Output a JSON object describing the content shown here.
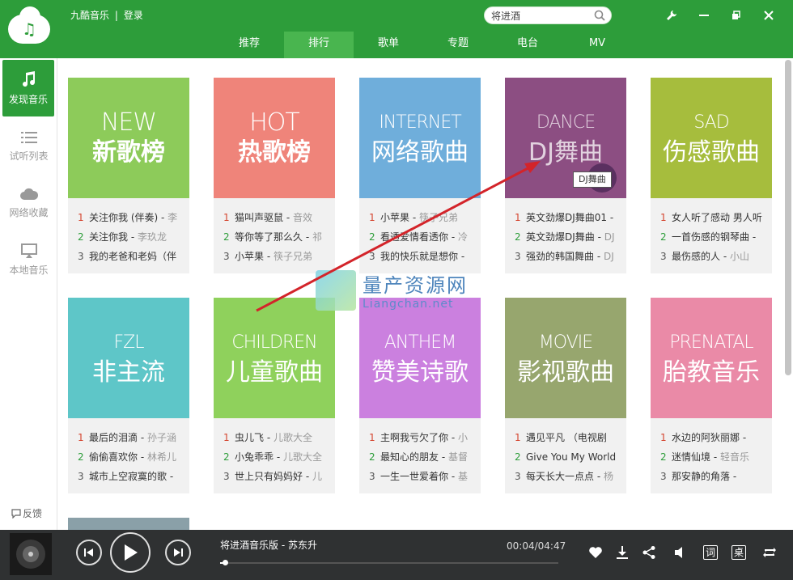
{
  "app": {
    "title": "九酷音乐",
    "separator": "|",
    "login": "登录"
  },
  "search": {
    "value": "将进酒",
    "placeholder": ""
  },
  "nav": {
    "tabs": [
      "推荐",
      "排行",
      "歌单",
      "专题",
      "电台",
      "MV"
    ],
    "active": "排行"
  },
  "sidebar": {
    "items": [
      {
        "label": "发现音乐",
        "icon": "music-note-icon",
        "active": true
      },
      {
        "label": "试听列表",
        "icon": "list-icon",
        "active": false
      },
      {
        "label": "网络收藏",
        "icon": "cloud-icon",
        "active": false
      },
      {
        "label": "本地音乐",
        "icon": "monitor-icon",
        "active": false
      }
    ],
    "feedback": "反馈"
  },
  "charts": [
    {
      "en": "NEW",
      "cn": "新歌榜",
      "color": "#8dcb5a",
      "songs": [
        {
          "title": "关注你我 (伴奏)",
          "artist": "李"
        },
        {
          "title": "关注你我",
          "artist": "李玖龙"
        },
        {
          "title": "我的老爸和老妈（伴",
          "artist": ""
        }
      ]
    },
    {
      "en": "HOT",
      "cn": "热歌榜",
      "color": "#ef847a",
      "songs": [
        {
          "title": "猫叫声驱鼠",
          "artist": "音效"
        },
        {
          "title": "等你等了那么久",
          "artist": "祁"
        },
        {
          "title": "小苹果",
          "artist": "筷子兄弟"
        }
      ]
    },
    {
      "en": "INTERNET",
      "cn": "网络歌曲",
      "color": "#6faedb",
      "songs": [
        {
          "title": "小苹果",
          "artist": "筷子兄弟"
        },
        {
          "title": "看透爱情看透你",
          "artist": "冷"
        },
        {
          "title": "我的快乐就是想你",
          "artist": ""
        }
      ]
    },
    {
      "en": "DANCE",
      "cn": "DJ舞曲",
      "color": "#8c4e82",
      "songs": [
        {
          "title": "英文劲爆DJ舞曲01",
          "artist": ""
        },
        {
          "title": "英文劲爆DJ舞曲",
          "artist": "DJ"
        },
        {
          "title": "强劲的韩国舞曲",
          "artist": "DJ"
        }
      ]
    },
    {
      "en": "SAD",
      "cn": "伤感歌曲",
      "color": "#a6bd3d",
      "songs": [
        {
          "title": "女人听了感动 男人听",
          "artist": ""
        },
        {
          "title": "一首伤感的钢琴曲",
          "artist": ""
        },
        {
          "title": "最伤感的人",
          "artist": "小山"
        }
      ]
    },
    {
      "en": "FZL",
      "cn": "非主流",
      "color": "#5ec6c8",
      "songs": [
        {
          "title": "最后的泪滴",
          "artist": "孙子涵"
        },
        {
          "title": "偷偷喜欢你",
          "artist": "林希儿"
        },
        {
          "title": "城市上空寂寞的歌",
          "artist": ""
        }
      ]
    },
    {
      "en": "CHILDREN",
      "cn": "儿童歌曲",
      "color": "#8fd15c",
      "songs": [
        {
          "title": "虫儿飞",
          "artist": "儿歌大全"
        },
        {
          "title": "小兔乖乖",
          "artist": "儿歌大全"
        },
        {
          "title": "世上只有妈妈好",
          "artist": "儿"
        }
      ]
    },
    {
      "en": "ANTHEM",
      "cn": "赞美诗歌",
      "color": "#cb80df",
      "songs": [
        {
          "title": "主啊我亏欠了你",
          "artist": "小"
        },
        {
          "title": "最知心的朋友",
          "artist": "基督"
        },
        {
          "title": "一生一世爱着你",
          "artist": "基"
        }
      ]
    },
    {
      "en": "MOVIE",
      "cn": "影视歌曲",
      "color": "#97a66e",
      "songs": [
        {
          "title": "遇见平凡 （电视剧",
          "artist": ""
        },
        {
          "title": "Give You My World",
          "artist": ""
        },
        {
          "title": "每天长大一点点",
          "artist": "杨"
        }
      ]
    },
    {
      "en": "PRENATAL",
      "cn": "胎教音乐",
      "color": "#ea8aa7",
      "songs": [
        {
          "title": "水边的阿狄丽娜",
          "artist": ""
        },
        {
          "title": "迷情仙境",
          "artist": "轻音乐"
        },
        {
          "title": "那安静的角落",
          "artist": ""
        }
      ]
    }
  ],
  "tooltip": "DJ舞曲",
  "watermark": {
    "line1": "量产资源网",
    "line2": "Liangchan.net"
  },
  "player": {
    "song": "将进酒音乐版 - 苏东升",
    "time": "00:04/04:47",
    "progress": 0.014,
    "lyric_label": "词",
    "desktop_label": "桌"
  }
}
